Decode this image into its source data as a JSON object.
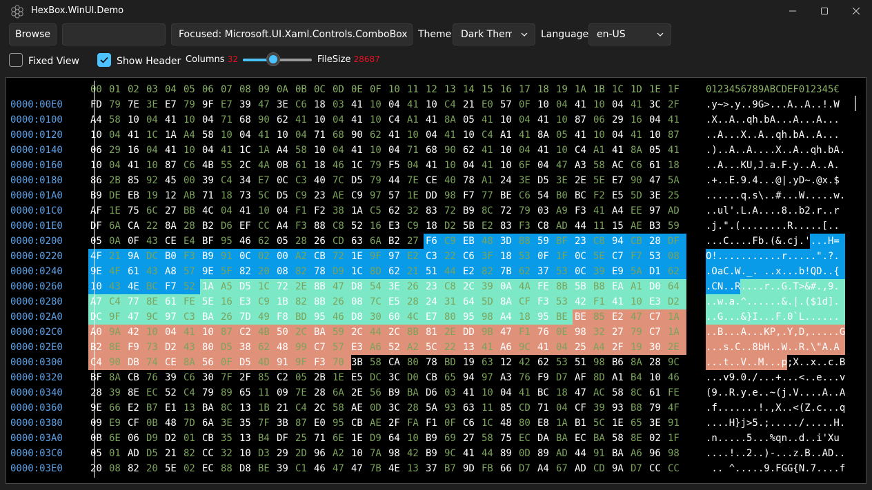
{
  "window": {
    "title": "HexBox.WinUI.Demo",
    "controls": {
      "minimize_icon": "minimize-icon",
      "maximize_icon": "maximize-icon",
      "close_icon": "close-icon"
    }
  },
  "toolbar": {
    "browse_label": "Browse",
    "path_value": "",
    "focus_text": "Focused: Microsoft.UI.Xaml.Controls.ComboBox",
    "theme_label": "Theme",
    "theme_value": "Dark Theme",
    "language_label": "Language",
    "language_value": "en-US"
  },
  "options": {
    "fixed_view_label": "Fixed View",
    "fixed_view_checked": false,
    "show_header_label": "Show Header",
    "show_header_checked": true,
    "columns_label": "Columns",
    "columns_value": "32",
    "columns_slider_fraction": 0.44,
    "filesize_label": "FileSize",
    "filesize_value": "28687"
  },
  "hex": {
    "column_headers": [
      "00",
      "01",
      "02",
      "03",
      "04",
      "05",
      "06",
      "07",
      "08",
      "09",
      "0A",
      "0B",
      "0C",
      "0D",
      "0E",
      "0F",
      "10",
      "11",
      "12",
      "13",
      "14",
      "15",
      "16",
      "17",
      "18",
      "19",
      "1A",
      "1B",
      "1C",
      "1D",
      "1E",
      "1F"
    ],
    "ascii_header": "0123456789ABCDEF012345€",
    "rows": [
      {
        "offset": "0000:00E0",
        "bytes": [
          "FD",
          "79",
          "7E",
          "3E",
          "E7",
          "79",
          "9F",
          "E7",
          "39",
          "47",
          "3E",
          "C6",
          "18",
          "03",
          "41",
          "10",
          "04",
          "41",
          "10",
          "C4",
          "21",
          "E0",
          "57",
          "0F",
          "10",
          "04",
          "41",
          "10",
          "04",
          "41",
          "3C",
          "2F"
        ],
        "ascii": ".y~>.y..9G>...A..A..!.W"
      },
      {
        "offset": "0000:0100",
        "bytes": [
          "A4",
          "58",
          "10",
          "04",
          "41",
          "10",
          "04",
          "71",
          "68",
          "90",
          "62",
          "41",
          "10",
          "04",
          "41",
          "10",
          "C4",
          "A1",
          "41",
          "8A",
          "05",
          "41",
          "10",
          "04",
          "41",
          "10",
          "87",
          "06",
          "29",
          "16",
          "04",
          "41"
        ],
        "ascii": ".X..A..qh.bA...A...A..."
      },
      {
        "offset": "0000:0120",
        "bytes": [
          "10",
          "04",
          "41",
          "1C",
          "1A",
          "A4",
          "58",
          "10",
          "04",
          "41",
          "10",
          "04",
          "71",
          "68",
          "90",
          "62",
          "41",
          "10",
          "04",
          "41",
          "10",
          "C4",
          "A1",
          "41",
          "8A",
          "05",
          "41",
          "10",
          "04",
          "41",
          "10",
          "87"
        ],
        "ascii": "..A...X..A..qh.bA..A..."
      },
      {
        "offset": "0000:0140",
        "bytes": [
          "06",
          "29",
          "16",
          "04",
          "41",
          "10",
          "04",
          "41",
          "1C",
          "1A",
          "A4",
          "58",
          "10",
          "04",
          "41",
          "10",
          "04",
          "71",
          "68",
          "90",
          "62",
          "41",
          "10",
          "04",
          "41",
          "10",
          "C4",
          "A1",
          "41",
          "8A",
          "05",
          "41"
        ],
        "ascii": ".)..A..A....X..A..qh.bA."
      },
      {
        "offset": "0000:0160",
        "bytes": [
          "10",
          "04",
          "41",
          "10",
          "87",
          "C6",
          "4B",
          "55",
          "2C",
          "4A",
          "0B",
          "61",
          "18",
          "46",
          "1C",
          "79",
          "F5",
          "04",
          "41",
          "10",
          "04",
          "41",
          "10",
          "6F",
          "04",
          "47",
          "A3",
          "58",
          "AC",
          "C6",
          "61",
          "18"
        ],
        "ascii": "..A...KU,J.a.F.y..A..A."
      },
      {
        "offset": "0000:0180",
        "bytes": [
          "86",
          "2B",
          "85",
          "92",
          "45",
          "00",
          "39",
          "C4",
          "34",
          "E7",
          "0C",
          "C3",
          "40",
          "7C",
          "D5",
          "79",
          "44",
          "7E",
          "CE",
          "40",
          "78",
          "A1",
          "24",
          "3E",
          "D5",
          "3E",
          "2E",
          "5E",
          "E7",
          "90",
          "47",
          "5A"
        ],
        "ascii": ".+..E.9.4...@|.yD~.@x.$"
      },
      {
        "offset": "0000:01A0",
        "bytes": [
          "B9",
          "DE",
          "EB",
          "19",
          "12",
          "AB",
          "71",
          "18",
          "73",
          "5C",
          "D5",
          "C9",
          "23",
          "AE",
          "C9",
          "97",
          "57",
          "1E",
          "DD",
          "98",
          "F7",
          "77",
          "BE",
          "C6",
          "54",
          "B0",
          "BC",
          "F2",
          "E5",
          "5D",
          "3E",
          "25"
        ],
        "ascii": "......q.s\\..#...W.....w."
      },
      {
        "offset": "0000:01C0",
        "bytes": [
          "AF",
          "1E",
          "75",
          "6C",
          "27",
          "BB",
          "4C",
          "04",
          "41",
          "10",
          "04",
          "F1",
          "F2",
          "38",
          "1A",
          "C5",
          "62",
          "32",
          "83",
          "72",
          "B9",
          "8C",
          "72",
          "79",
          "03",
          "A9",
          "F3",
          "41",
          "A4",
          "EE",
          "97",
          "AD"
        ],
        "ascii": "..ul'.L.A....8..b2.r..r"
      },
      {
        "offset": "0000:01E0",
        "bytes": [
          "DF",
          "6A",
          "CA",
          "22",
          "8A",
          "28",
          "B2",
          "D6",
          "EF",
          "CC",
          "A4",
          "F3",
          "88",
          "C8",
          "52",
          "16",
          "E3",
          "C9",
          "18",
          "D2",
          "5B",
          "E2",
          "83",
          "F3",
          "C8",
          "AD",
          "44",
          "11",
          "15",
          "AE",
          "B3",
          "59"
        ],
        "ascii": ".j.\".(........R.....[.."
      },
      {
        "offset": "0000:0200",
        "bytes": [
          "05",
          "0A",
          "0F",
          "43",
          "CE",
          "E4",
          "BF",
          "95",
          "46",
          "62",
          "05",
          "28",
          "26",
          "CD",
          "63",
          "6A",
          "B2",
          "27",
          "F6",
          "C9",
          "EB",
          "48",
          "3D",
          "88",
          "59",
          "BF",
          "23",
          "C8",
          "94",
          "CB",
          "28",
          "DF"
        ],
        "ascii": "...C....Fb.(&.cj.'...H="
      },
      {
        "offset": "0000:0220",
        "bytes": [
          "4F",
          "21",
          "9A",
          "DC",
          "B0",
          "F3",
          "B9",
          "91",
          "0C",
          "02",
          "00",
          "A2",
          "CB",
          "72",
          "1E",
          "9F",
          "97",
          "E2",
          "C3",
          "22",
          "C6",
          "3F",
          "18",
          "53",
          "0F",
          "1F",
          "0C",
          "5E",
          "C7",
          "F7",
          "53",
          "08"
        ],
        "ascii": "O!...........r.....\".?."
      },
      {
        "offset": "0000:0240",
        "bytes": [
          "9E",
          "4F",
          "61",
          "43",
          "A8",
          "57",
          "9E",
          "5F",
          "82",
          "20",
          "08",
          "82",
          "78",
          "D9",
          "1C",
          "8D",
          "62",
          "21",
          "51",
          "44",
          "E2",
          "82",
          "7B",
          "62",
          "37",
          "53",
          "0C",
          "39",
          "E9",
          "5A",
          "D1",
          "62"
        ],
        "ascii": ".OaC.W._. ..x...b!QD..{"
      },
      {
        "offset": "0000:0260",
        "bytes": [
          "10",
          "43",
          "4E",
          "BC",
          "F7",
          "52",
          "1A",
          "A5",
          "D5",
          "1C",
          "72",
          "2E",
          "8B",
          "47",
          "D8",
          "54",
          "3E",
          "26",
          "23",
          "C8",
          "2C",
          "39",
          "0A",
          "4A",
          "FE",
          "8B",
          "5B",
          "B8",
          "EA",
          "A1",
          "D0",
          "64"
        ],
        "ascii": ".CN..R....r..G.T>&#.,9."
      },
      {
        "offset": "0000:0280",
        "bytes": [
          "A7",
          "C4",
          "77",
          "8E",
          "61",
          "FE",
          "5E",
          "16",
          "E3",
          "C9",
          "1B",
          "82",
          "8B",
          "26",
          "08",
          "7C",
          "E5",
          "28",
          "24",
          "31",
          "64",
          "5D",
          "8A",
          "CF",
          "F3",
          "53",
          "42",
          "F1",
          "41",
          "10",
          "E3",
          "D2"
        ],
        "ascii": "..w.a.^......&.|.($1d]."
      },
      {
        "offset": "0000:02A0",
        "bytes": [
          "DC",
          "9F",
          "47",
          "9C",
          "97",
          "C3",
          "BA",
          "26",
          "7D",
          "49",
          "F8",
          "BD",
          "95",
          "46",
          "D8",
          "30",
          "60",
          "4C",
          "E7",
          "80",
          "95",
          "98",
          "A4",
          "18",
          "95",
          "BE",
          "BE",
          "85",
          "E2",
          "47",
          "C7",
          "1A"
        ],
        "ascii": "..G...&}I...F.0`L......"
      },
      {
        "offset": "0000:02C0",
        "bytes": [
          "A0",
          "9A",
          "42",
          "10",
          "04",
          "41",
          "10",
          "87",
          "C2",
          "4B",
          "50",
          "2C",
          "BA",
          "59",
          "2C",
          "44",
          "2C",
          "8B",
          "81",
          "2E",
          "DD",
          "9B",
          "47",
          "F1",
          "76",
          "0E",
          "98",
          "32",
          "27",
          "79",
          "C7",
          "1A"
        ],
        "ascii": "..B...A...KP,.Y,D,.....G"
      },
      {
        "offset": "0000:02E0",
        "bytes": [
          "B2",
          "8E",
          "F9",
          "73",
          "D2",
          "43",
          "80",
          "D5",
          "38",
          "62",
          "48",
          "99",
          "C7",
          "57",
          "E3",
          "A6",
          "52",
          "A2",
          "5C",
          "22",
          "13",
          "41",
          "A6",
          "9C",
          "41",
          "04",
          "25",
          "A4",
          "2F",
          "19",
          "30",
          "2E"
        ],
        "ascii": "...s.C..8bH..W..R.\\\"A.A"
      },
      {
        "offset": "0000:0300",
        "bytes": [
          "C4",
          "90",
          "DB",
          "74",
          "CE",
          "8A",
          "56",
          "0F",
          "D5",
          "4D",
          "91",
          "9F",
          "F3",
          "70",
          "3B",
          "58",
          "CA",
          "80",
          "78",
          "BD",
          "19",
          "63",
          "12",
          "42",
          "62",
          "53",
          "51",
          "98",
          "B6",
          "8A",
          "28",
          "9C"
        ],
        "ascii": "...t..V..M...p;X..x..c.B"
      },
      {
        "offset": "0000:0320",
        "bytes": [
          "BF",
          "8A",
          "CB",
          "76",
          "39",
          "C6",
          "30",
          "7F",
          "2F",
          "85",
          "C2",
          "05",
          "2B",
          "1E",
          "E5",
          "DC",
          "3C",
          "D0",
          "CB",
          "65",
          "94",
          "97",
          "A3",
          "76",
          "F9",
          "D7",
          "AF",
          "8D",
          "A1",
          "B4",
          "10",
          "46"
        ],
        "ascii": "...v9.0./...+...<..e...v"
      },
      {
        "offset": "0000:0340",
        "bytes": [
          "28",
          "39",
          "8E",
          "EC",
          "52",
          "C4",
          "79",
          "89",
          "65",
          "11",
          "09",
          "7E",
          "28",
          "6A",
          "2E",
          "56",
          "B9",
          "BA",
          "D6",
          "03",
          "41",
          "10",
          "04",
          "41",
          "BC",
          "18",
          "47",
          "AC",
          "58",
          "8C",
          "61",
          "FE"
        ],
        "ascii": "(9..R.y.e..~(j.V....A..A"
      },
      {
        "offset": "0000:0360",
        "bytes": [
          "9E",
          "66",
          "E2",
          "B7",
          "E1",
          "13",
          "BA",
          "8C",
          "13",
          "1B",
          "21",
          "C4",
          "2C",
          "58",
          "AE",
          "0D",
          "3C",
          "28",
          "5A",
          "93",
          "63",
          "11",
          "85",
          "CD",
          "71",
          "04",
          "CF",
          "39",
          "93",
          "B8",
          "79",
          "4F"
        ],
        "ascii": ".f.......!.,X..<(Z.c...q"
      },
      {
        "offset": "0000:0380",
        "bytes": [
          "09",
          "E9",
          "CF",
          "0B",
          "48",
          "7D",
          "6A",
          "3E",
          "35",
          "7F",
          "3B",
          "87",
          "E0",
          "95",
          "CB",
          "AE",
          "2F",
          "FA",
          "F1",
          "0F",
          "C6",
          "1C",
          "48",
          "80",
          "E8",
          "1A",
          "B1",
          "5C",
          "1E",
          "65",
          "3E",
          "91"
        ],
        "ascii": "....H}j>5.;...../.....H.."
      },
      {
        "offset": "0000:03A0",
        "bytes": [
          "0B",
          "6E",
          "06",
          "D9",
          "D2",
          "01",
          "CB",
          "35",
          "13",
          "B4",
          "DF",
          "25",
          "71",
          "6E",
          "1E",
          "D9",
          "64",
          "10",
          "B9",
          "69",
          "27",
          "58",
          "75",
          "EC",
          "DA",
          "BA",
          "EC",
          "BA",
          "58",
          "8E",
          "02",
          "1F"
        ],
        "ascii": ".n.....5...%qn..d..i'Xu"
      },
      {
        "offset": "0000:03C0",
        "bytes": [
          "05",
          "01",
          "AD",
          "D5",
          "21",
          "82",
          "CC",
          "32",
          "10",
          "D3",
          "29",
          "2D",
          "96",
          "A2",
          "10",
          "7A",
          "98",
          "42",
          "B9",
          "9C",
          "41",
          "44",
          "89",
          "0D",
          "89",
          "AD",
          "44",
          "91",
          "BA",
          "A6",
          "96",
          "98"
        ],
        "ascii": "....!..2..)-...z.B..AD.."
      },
      {
        "offset": "0000:03E0",
        "bytes": [
          "20",
          "08",
          "82",
          "20",
          "5E",
          "02",
          "EC",
          "88",
          "D8",
          "BE",
          "39",
          "C1",
          "46",
          "47",
          "47",
          "7B",
          "4E",
          "13",
          "37",
          "B7",
          "9D",
          "FB",
          "66",
          "D7",
          "A4",
          "67",
          "AD",
          "CD",
          "9A",
          "D7",
          "CC",
          "CC"
        ],
        "ascii": " .. ^.....9.FGG{N.7....f"
      }
    ],
    "highlights": [
      {
        "name": "selection-blue",
        "color": "#0a9be8",
        "start": 530,
        "end": 613
      },
      {
        "name": "selection-mint",
        "color": "#7de8c6",
        "start": 614,
        "end": 697
      },
      {
        "name": "selection-salmon",
        "color": "#e0917a",
        "start": 698,
        "end": 781
      }
    ]
  }
}
